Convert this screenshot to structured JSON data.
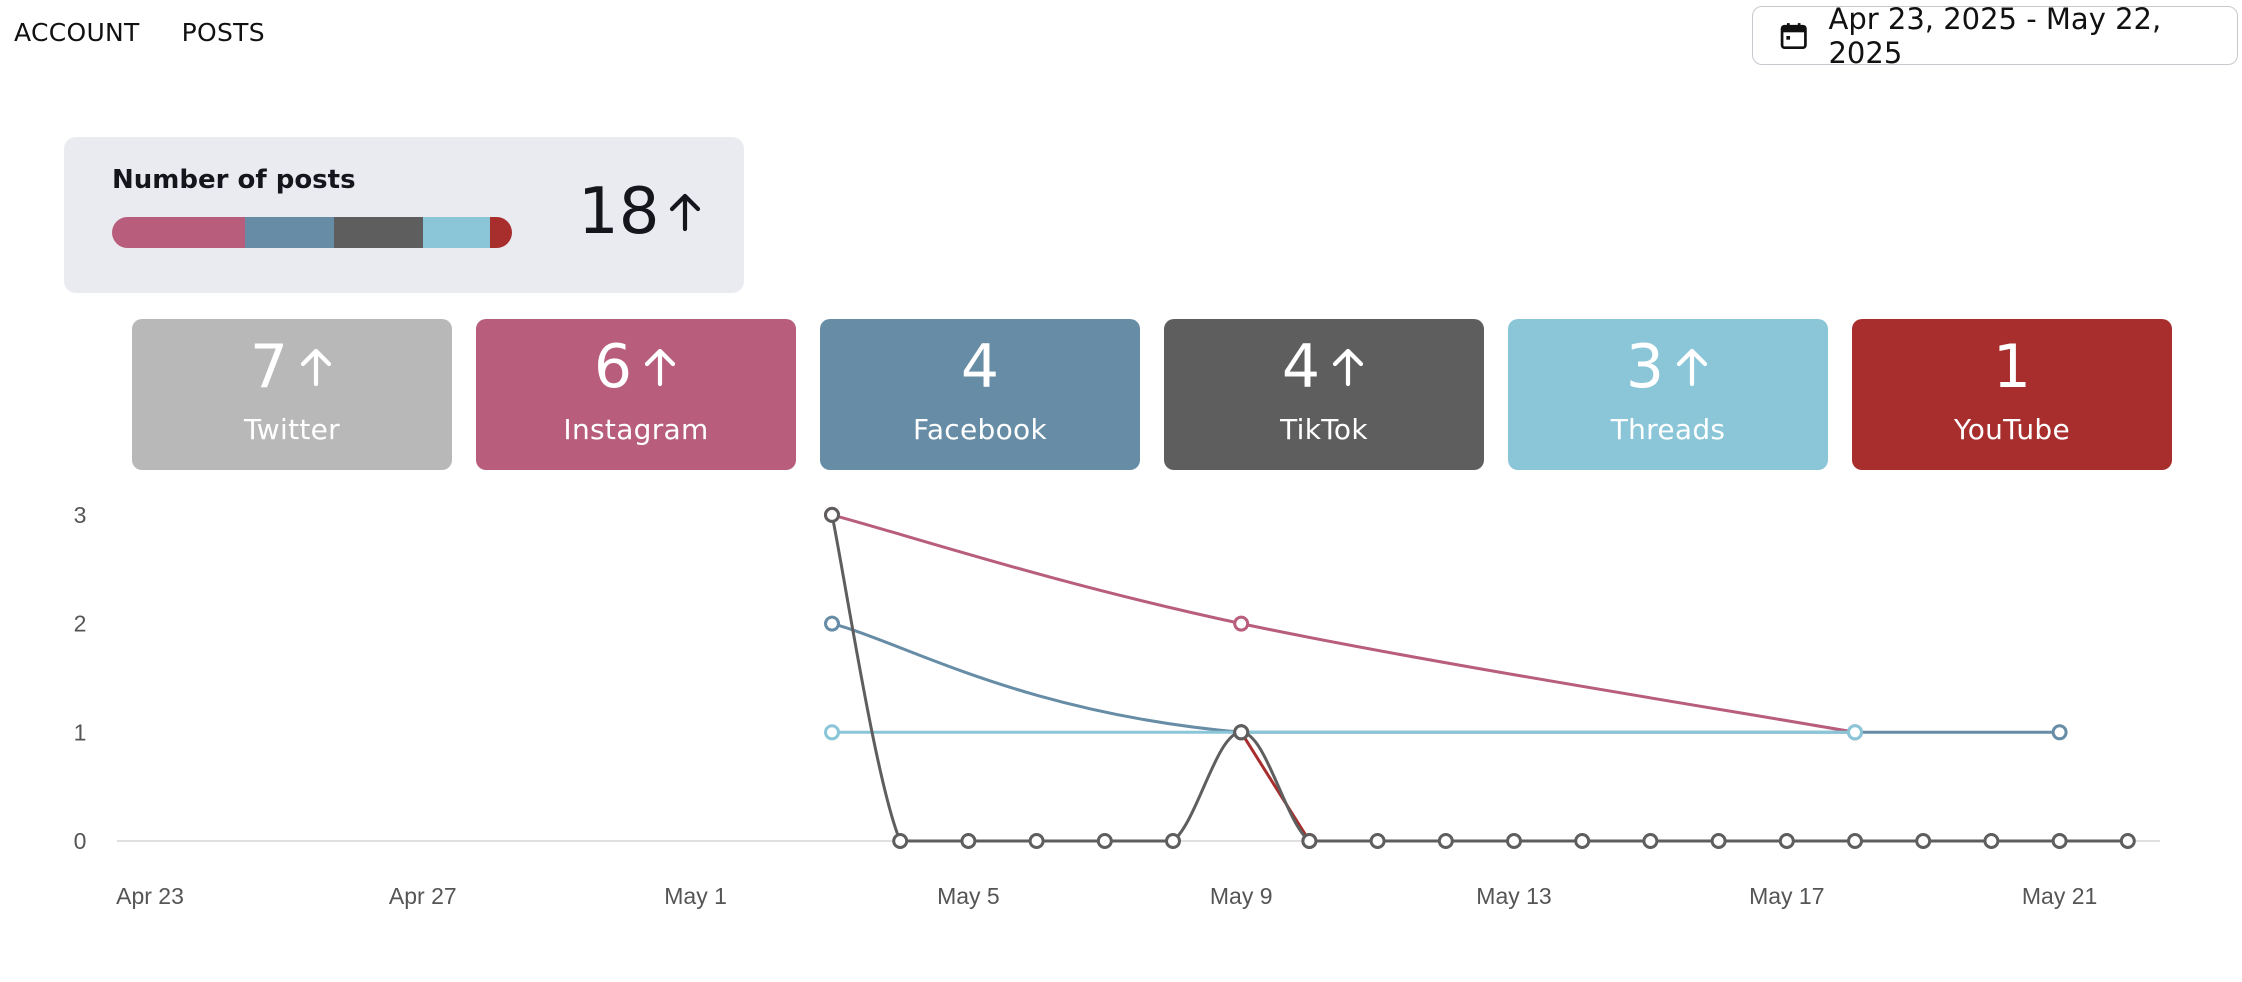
{
  "nav": {
    "account_label": "ACCOUNT",
    "posts_label": "POSTS"
  },
  "date_range": {
    "label": "Apr 23, 2025 - May 22, 2025",
    "icon": "calendar-icon"
  },
  "summary": {
    "title": "Number of posts",
    "count": "18",
    "trend": "up",
    "bar_segments": [
      {
        "name": "Instagram",
        "value": 6,
        "color": "#b85e7c"
      },
      {
        "name": "Facebook",
        "value": 4,
        "color": "#668ca6"
      },
      {
        "name": "TikTok",
        "value": 4,
        "color": "#5e5e5e"
      },
      {
        "name": "Threads",
        "value": 3,
        "color": "#8ac6d8"
      },
      {
        "name": "YouTube",
        "value": 1,
        "color": "#a82d2d"
      }
    ]
  },
  "platforms": [
    {
      "name": "Twitter",
      "count": "7",
      "trend": "up",
      "color": "#b8b8b8"
    },
    {
      "name": "Instagram",
      "count": "6",
      "trend": "up",
      "color": "#b85e7c"
    },
    {
      "name": "Facebook",
      "count": "4",
      "trend": "none",
      "color": "#668ca6"
    },
    {
      "name": "TikTok",
      "count": "4",
      "trend": "up",
      "color": "#5e5e5e"
    },
    {
      "name": "Threads",
      "count": "3",
      "trend": "up",
      "color": "#8ac6d8"
    },
    {
      "name": "YouTube",
      "count": "1",
      "trend": "none",
      "color": "#a82d2d"
    }
  ],
  "chart_data": {
    "type": "line",
    "x_start": "Apr 23",
    "x_ticks": [
      "Apr 23",
      "Apr 27",
      "May 1",
      "May 5",
      "May 9",
      "May 13",
      "May 17",
      "May 21"
    ],
    "x_tick_day_offsets": [
      0,
      4,
      8,
      12,
      16,
      20,
      24,
      28
    ],
    "ylim": [
      0,
      3
    ],
    "y_ticks": [
      0,
      1,
      2,
      3
    ],
    "grid": false,
    "series": [
      {
        "name": "Instagram",
        "color": "#b85e7c",
        "points": [
          [
            "May 3",
            3
          ],
          [
            "May 9",
            2
          ],
          [
            "May 18",
            1
          ]
        ]
      },
      {
        "name": "Facebook",
        "color": "#668ca6",
        "points": [
          [
            "May 3",
            2
          ],
          [
            "May 9",
            1
          ],
          [
            "May 21",
            1
          ]
        ]
      },
      {
        "name": "Threads",
        "color": "#8ac6d8",
        "points": [
          [
            "May 3",
            1
          ],
          [
            "May 9",
            1
          ],
          [
            "May 18",
            1
          ]
        ]
      },
      {
        "name": "YouTube",
        "color": "#a82d2d",
        "points": [
          [
            "May 9",
            1
          ],
          [
            "May 10",
            0
          ]
        ]
      },
      {
        "name": "TikTok",
        "color": "#5e5e5e",
        "points": [
          [
            "May 3",
            3
          ],
          [
            "May 4",
            0
          ],
          [
            "May 5",
            0
          ],
          [
            "May 6",
            0
          ],
          [
            "May 7",
            0
          ],
          [
            "May 8",
            0
          ],
          [
            "May 9",
            1
          ],
          [
            "May 10",
            0
          ],
          [
            "May 11",
            0
          ],
          [
            "May 12",
            0
          ],
          [
            "May 13",
            0
          ],
          [
            "May 14",
            0
          ],
          [
            "May 15",
            0
          ],
          [
            "May 16",
            0
          ],
          [
            "May 17",
            0
          ],
          [
            "May 18",
            0
          ],
          [
            "May 19",
            0
          ],
          [
            "May 20",
            0
          ],
          [
            "May 21",
            0
          ],
          [
            "May 22",
            0
          ]
        ]
      }
    ]
  }
}
